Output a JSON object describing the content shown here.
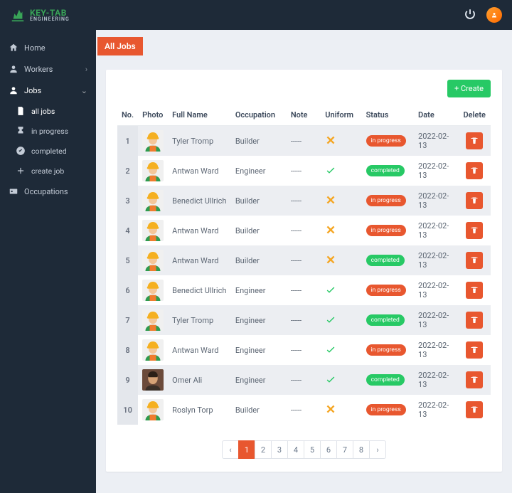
{
  "brand": {
    "main": "KEY-TAB",
    "sub": "ENGINEERING"
  },
  "sidebar": {
    "home": "Home",
    "workers": "Workers",
    "jobs": "Jobs",
    "sub": {
      "all": "all jobs",
      "inprogress": "in progress",
      "completed": "completed",
      "create": "create job"
    },
    "occupations": "Occupations"
  },
  "page": {
    "title": "All Jobs",
    "create_btn": "+ Create"
  },
  "table": {
    "headers": {
      "no": "No.",
      "photo": "Photo",
      "name": "Full Name",
      "occ": "Occupation",
      "note": "Note",
      "uni": "Uniform",
      "status": "Status",
      "date": "Date",
      "del": "Delete"
    },
    "rows": [
      {
        "no": "1",
        "name": "Tyler Tromp",
        "occ": "Builder",
        "note": "-----",
        "uni": false,
        "status": "in progress",
        "date": "2022-02-13",
        "avatar": "worker"
      },
      {
        "no": "2",
        "name": "Antwan Ward",
        "occ": "Engineer",
        "note": "-----",
        "uni": true,
        "status": "completed",
        "date": "2022-02-13",
        "avatar": "worker"
      },
      {
        "no": "3",
        "name": "Benedict Ullrich",
        "occ": "Builder",
        "note": "-----",
        "uni": false,
        "status": "in progress",
        "date": "2022-02-13",
        "avatar": "worker"
      },
      {
        "no": "4",
        "name": "Antwan Ward",
        "occ": "Builder",
        "note": "-----",
        "uni": false,
        "status": "in progress",
        "date": "2022-02-13",
        "avatar": "worker"
      },
      {
        "no": "5",
        "name": "Antwan Ward",
        "occ": "Builder",
        "note": "-----",
        "uni": false,
        "status": "completed",
        "date": "2022-02-13",
        "avatar": "worker"
      },
      {
        "no": "6",
        "name": "Benedict Ullrich",
        "occ": "Engineer",
        "note": "-----",
        "uni": true,
        "status": "in progress",
        "date": "2022-02-13",
        "avatar": "worker"
      },
      {
        "no": "7",
        "name": "Tyler Tromp",
        "occ": "Engineer",
        "note": "-----",
        "uni": true,
        "status": "completed",
        "date": "2022-02-13",
        "avatar": "worker"
      },
      {
        "no": "8",
        "name": "Antwan Ward",
        "occ": "Engineer",
        "note": "-----",
        "uni": true,
        "status": "in progress",
        "date": "2022-02-13",
        "avatar": "worker"
      },
      {
        "no": "9",
        "name": "Omer Ali",
        "occ": "Engineer",
        "note": "-----",
        "uni": true,
        "status": "completed",
        "date": "2022-02-13",
        "avatar": "person"
      },
      {
        "no": "10",
        "name": "Roslyn Torp",
        "occ": "Builder",
        "note": "-----",
        "uni": false,
        "status": "in progress",
        "date": "2022-02-13",
        "avatar": "worker"
      }
    ]
  },
  "pagination": {
    "prev": "‹",
    "next": "›",
    "pages": [
      "1",
      "2",
      "3",
      "4",
      "5",
      "6",
      "7",
      "8"
    ],
    "active": "1"
  }
}
